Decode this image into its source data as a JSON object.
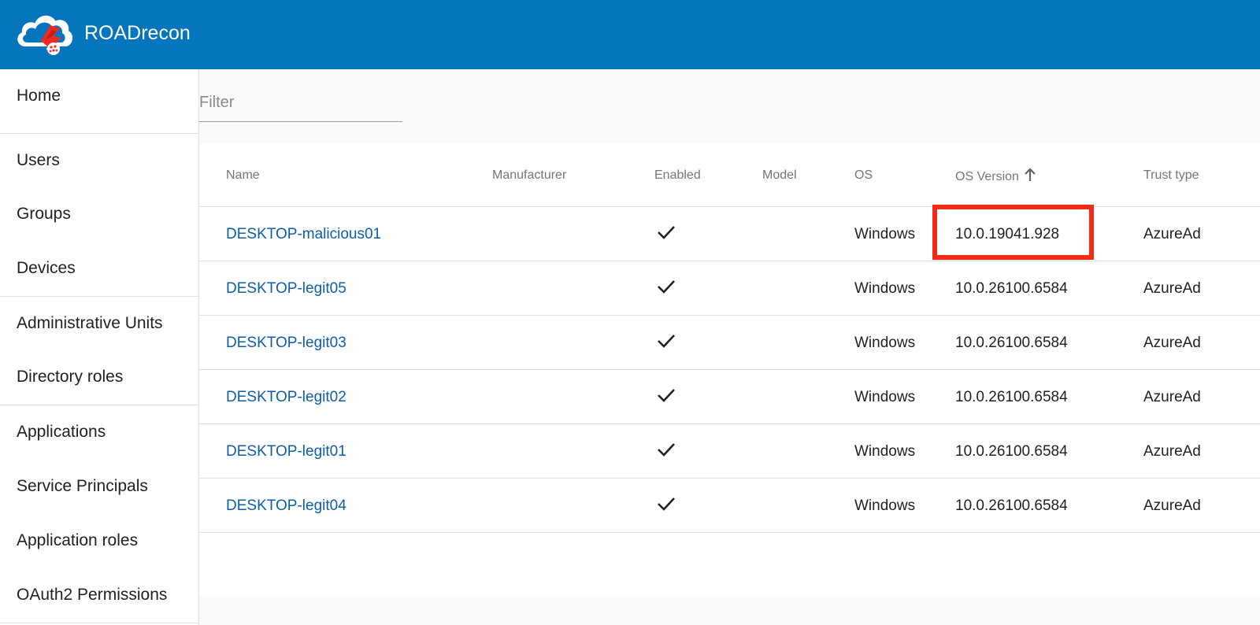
{
  "app": {
    "title": "ROADrecon"
  },
  "sidebar": {
    "items": [
      {
        "label": "Home"
      },
      {
        "label": "Users"
      },
      {
        "label": "Groups"
      },
      {
        "label": "Devices"
      },
      {
        "label": "Administrative Units"
      },
      {
        "label": "Directory roles"
      },
      {
        "label": "Applications"
      },
      {
        "label": "Service Principals"
      },
      {
        "label": "Application roles"
      },
      {
        "label": "OAuth2 Permissions"
      }
    ]
  },
  "filter": {
    "placeholder": "Filter",
    "value": ""
  },
  "table": {
    "columns": [
      "Name",
      "Manufacturer",
      "Enabled",
      "Model",
      "OS",
      "OS Version",
      "Trust type"
    ],
    "sort": {
      "column": "OS Version",
      "direction": "ascending",
      "icon": "arrow-up-icon"
    },
    "rows": [
      {
        "name": "DESKTOP-malicious01",
        "manufacturer": "",
        "enabled": true,
        "model": "",
        "os": "Windows",
        "os_version": "10.0.19041.928",
        "trust_type": "AzureAd"
      },
      {
        "name": "DESKTOP-legit05",
        "manufacturer": "",
        "enabled": true,
        "model": "",
        "os": "Windows",
        "os_version": "10.0.26100.6584",
        "trust_type": "AzureAd"
      },
      {
        "name": "DESKTOP-legit03",
        "manufacturer": "",
        "enabled": true,
        "model": "",
        "os": "Windows",
        "os_version": "10.0.26100.6584",
        "trust_type": "AzureAd"
      },
      {
        "name": "DESKTOP-legit02",
        "manufacturer": "",
        "enabled": true,
        "model": "",
        "os": "Windows",
        "os_version": "10.0.26100.6584",
        "trust_type": "AzureAd"
      },
      {
        "name": "DESKTOP-legit01",
        "manufacturer": "",
        "enabled": true,
        "model": "",
        "os": "Windows",
        "os_version": "10.0.26100.6584",
        "trust_type": "AzureAd"
      },
      {
        "name": "DESKTOP-legit04",
        "manufacturer": "",
        "enabled": true,
        "model": "",
        "os": "Windows",
        "os_version": "10.0.26100.6584",
        "trust_type": "AzureAd"
      }
    ]
  },
  "colors": {
    "header": "#0576bd",
    "link": "#0d5ea8",
    "highlight": "#f22b15"
  }
}
